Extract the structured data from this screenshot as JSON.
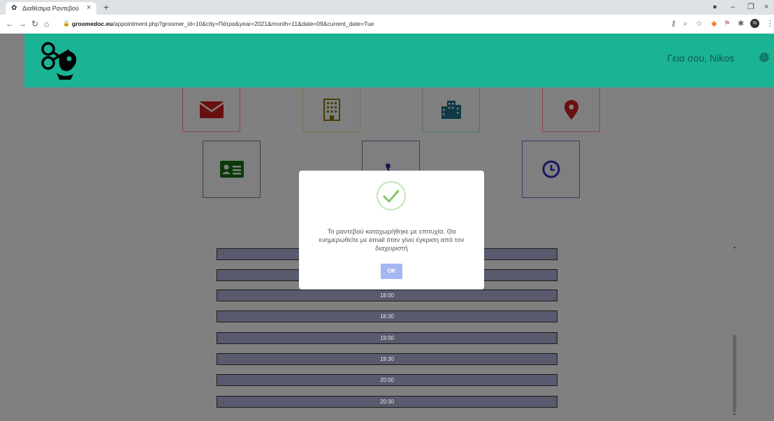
{
  "browser": {
    "tab_title": "Διαθέσιμα Ραντεβού",
    "tab_close": "×",
    "new_tab": "+",
    "url_host": "groomedoc.eu",
    "url_path": "/appointment.php?groomer_id=10&city=Πάτρα&year=2021&month=11&date=09&current_date=Tue",
    "profile_initial": "N"
  },
  "header": {
    "greeting": "Γεια σου, Nikos",
    "accent_color": "#1ab394"
  },
  "info_icons": {
    "row1": [
      "envelope-icon",
      "building-icon",
      "city-icon",
      "map-marker-icon"
    ],
    "row2": [
      "id-card-icon",
      "phone-icon",
      "clock-icon"
    ]
  },
  "time_slots": [
    "",
    "",
    "18:00",
    "18:30",
    "19:00",
    "19:30",
    "20:00",
    "20:30"
  ],
  "modal": {
    "message": "Το ραντεβού καταχωρήθηκε με επιτυχία. Θα ενημερωθείτε με email όταν γίνει έγκριση από τον διαχειριστή",
    "ok_label": "OK",
    "button_color": "#a5b7f1"
  }
}
